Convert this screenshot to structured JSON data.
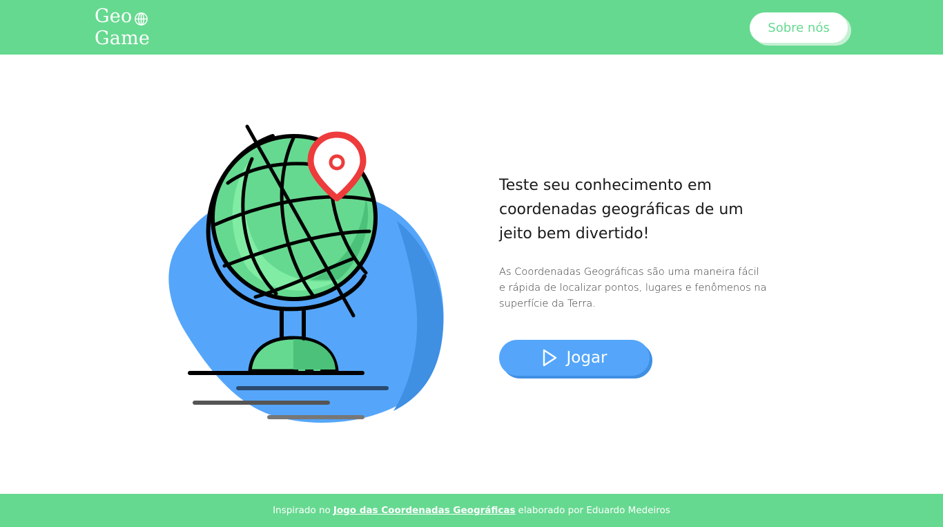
{
  "header": {
    "logo_line1": "Geo",
    "logo_line2": "Game",
    "about_label": "Sobre nós"
  },
  "main": {
    "headline": "Teste seu conhecimento em coordenadas geográficas de um jeito bem divertido!",
    "description": "As Coordenadas Geográficas são uma maneira fácil e rápida de localizar pontos, lugares e fenômenos na superfície da Terra.",
    "play_label": "Jogar",
    "play_icon": "play-icon"
  },
  "footer": {
    "prefix": "Inspirado no",
    "link_text": "Jogo das Coordenadas Geográficas",
    "suffix": "elaborado por Eduardo Medeiros"
  },
  "colors": {
    "brand_green": "#66d990",
    "accent_blue": "#55a6fa",
    "pin_red": "#ee3b3b"
  }
}
